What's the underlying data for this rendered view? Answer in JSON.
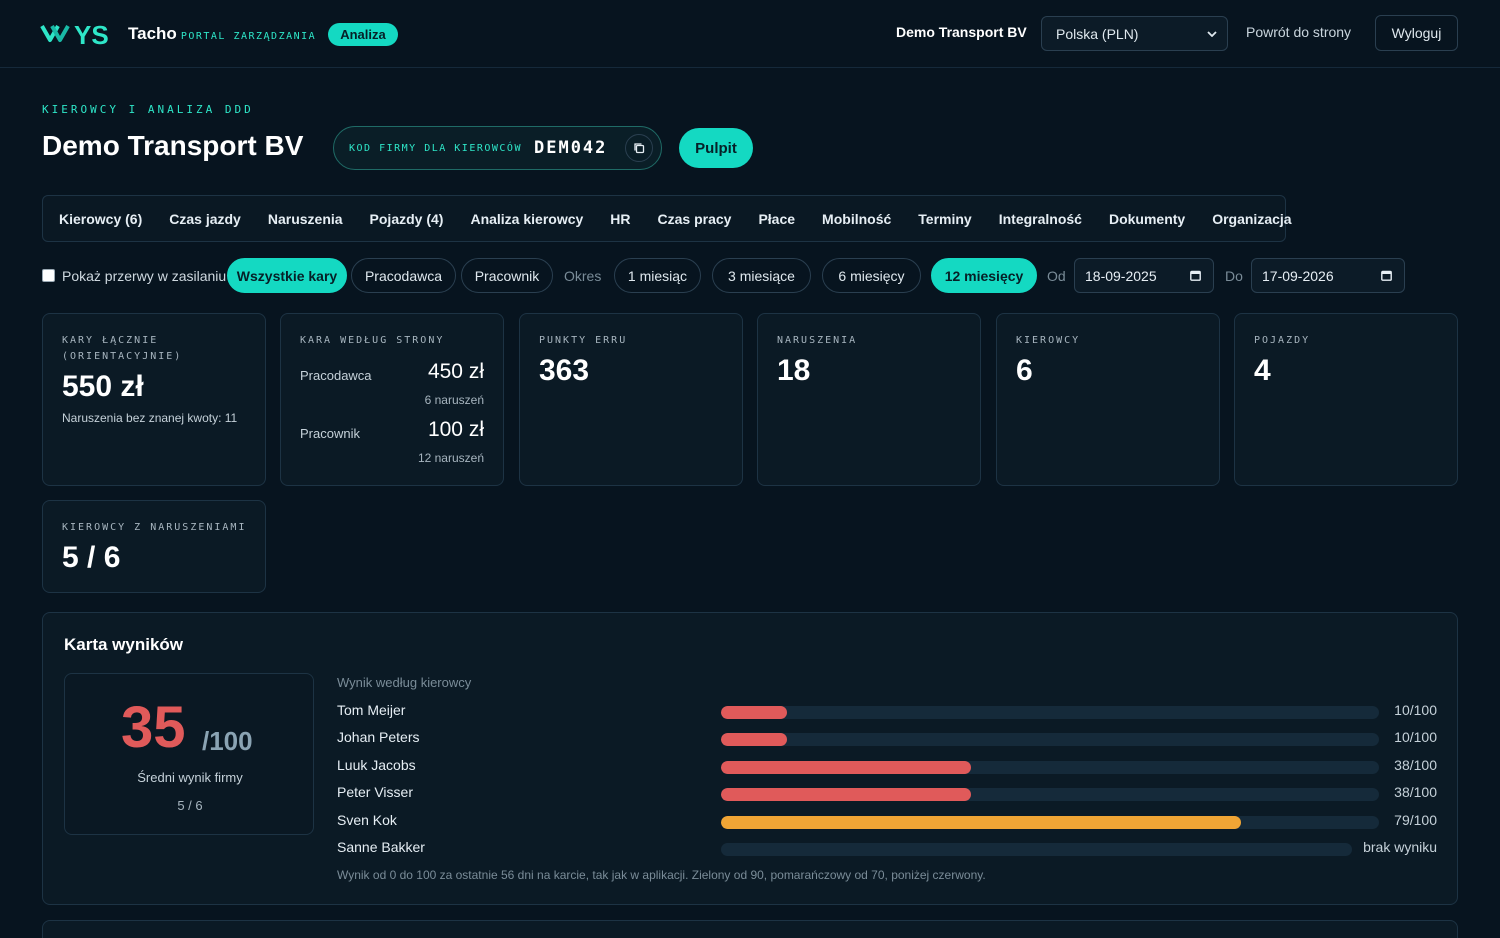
{
  "header": {
    "brand_mark": "YS",
    "brand": "Tacho",
    "brand_sub": "PORTAL ZARZĄDZANIA",
    "badge": "Analiza",
    "company": "Demo Transport BV",
    "country_select": "Polska (PLN)",
    "back_link": "Powrót do strony",
    "logout": "Wyloguj"
  },
  "page": {
    "eyebrow": "KIEROWCY I ANALIZA DDD",
    "title": "Demo Transport BV",
    "code_label": "KOD FIRMY DLA KIEROWCÓW",
    "code_value": "DEM042",
    "dashboard_button": "Pulpit"
  },
  "tabs": [
    "Kierowcy (6)",
    "Czas jazdy",
    "Naruszenia",
    "Pojazdy (4)",
    "Analiza kierowcy",
    "HR",
    "Czas pracy",
    "Płace",
    "Mobilność",
    "Terminy",
    "Integralność",
    "Dokumenty",
    "Organizacja"
  ],
  "filters": {
    "power_breaks_label": "Pokaż przerwy w zasilaniu",
    "fines": [
      "Wszystkie kary",
      "Pracodawca",
      "Pracownik"
    ],
    "period_label": "Okres",
    "periods": [
      "1 miesiąc",
      "3 miesiące",
      "6 miesięcy",
      "12 miesięcy"
    ],
    "from_label": "Od",
    "from_date": "18-09-2025",
    "to_label": "Do",
    "to_date": "17-09-2026"
  },
  "stats": {
    "total_fines_title": "KARY ŁĄCZNIE (ORIENTACYJNIE)",
    "total_fines_value": "550 zł",
    "total_fines_note": "Naruszenia bez znanej kwoty: 11",
    "by_party_title": "KARA WEDŁUG STRONY",
    "employer_label": "Pracodawca",
    "employer_value": "450 zł",
    "employer_sub": "6 naruszeń",
    "employee_label": "Pracownik",
    "employee_value": "100 zł",
    "employee_sub": "12 naruszeń",
    "erru_title": "PUNKTY ERRU",
    "erru_value": "363",
    "violations_title": "NARUSZENIA",
    "violations_value": "18",
    "drivers_title": "KIEROWCY",
    "drivers_value": "6",
    "vehicles_title": "POJAZDY",
    "vehicles_value": "4",
    "drivers_viol_title": "KIEROWCY Z NARUSZENIAMI",
    "drivers_viol_value": "5 / 6"
  },
  "scorecard": {
    "heading": "Karta wyników",
    "score": "35",
    "score_of": "/100",
    "score_caption": "Średni wynik firmy",
    "score_count": "5 / 6",
    "per_driver_label": "Wynik według kierowcy",
    "drivers": [
      {
        "name": "Tom Meijer",
        "score": 10,
        "label": "10/100"
      },
      {
        "name": "Johan Peters",
        "score": 10,
        "label": "10/100"
      },
      {
        "name": "Luuk Jacobs",
        "score": 38,
        "label": "38/100"
      },
      {
        "name": "Peter Visser",
        "score": 38,
        "label": "38/100"
      },
      {
        "name": "Sven Kok",
        "score": 79,
        "label": "79/100"
      },
      {
        "name": "Sanne Bakker",
        "score": null,
        "label": "brak wyniku"
      }
    ],
    "footnote": "Wynik od 0 do 100 za ostatnie 56 dni na karcie, tak jak w aplikacji. Zielony od 90, pomarańczowy od 70, poniżej czerwony.",
    "colors": {
      "red": "#e05a5a",
      "orange": "#f0a535",
      "green": "#2ecc71",
      "accent": "#14d9c2"
    }
  }
}
